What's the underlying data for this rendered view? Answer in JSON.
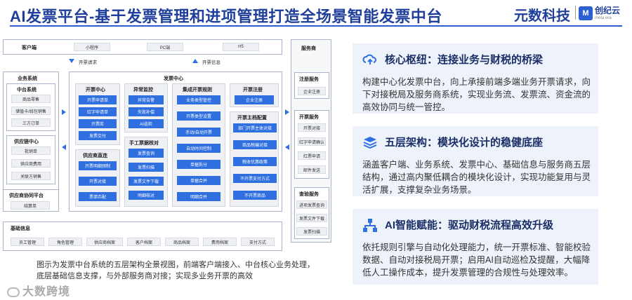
{
  "header": {
    "title": "AI发票平台-基于发票管理和进项管理打造全场景智能发票中台",
    "brand": "元数科技",
    "partner_name": "创纪云",
    "partner_sub": "meta era",
    "partner_mark": "M"
  },
  "diagram": {
    "customer": {
      "label": "客户端",
      "items": [
        "小程序",
        "PC端",
        "H5"
      ]
    },
    "arrows": {
      "request": "开票请求",
      "info": "开票信息"
    },
    "business": {
      "label": "业务系统",
      "center": {
        "label": "中台系统",
        "items": [
          "商品零售",
          "储值卡/线包销售",
          "三方订单"
        ]
      },
      "supply": {
        "label": "供应链中心",
        "items": [
          "批销单",
          "供应商费用",
          "关联方销售"
        ]
      },
      "collab": {
        "label": "供应商协同平台",
        "items": [
          "结算单"
        ]
      }
    },
    "invoice_center": {
      "label": "发票中心",
      "kp": {
        "label": "开票中心",
        "items": [
          "开票申请单",
          "红字申请单",
          "开票库",
          "发票交付"
        ]
      },
      "anomaly": {
        "label": "异常监控",
        "items": [
          "异常告警",
          "失败补偿",
          "AI巡检"
        ]
      },
      "rules": {
        "label": "集成开票规则",
        "items": [
          "业务类型管控",
          "开票类型设置",
          "手动/自动开票",
          "自动时间控制",
          "单据拆分",
          "单据合并",
          "明细合并"
        ]
      },
      "register": {
        "label": "开票注册",
        "items": [
          "企业注册"
        ]
      },
      "manual": {
        "label": "手工票据核对",
        "items": [
          "发票查询",
          "发票扫描",
          "发票文件下载",
          "明细核对"
        ]
      },
      "supplier": {
        "label": "供应商直连",
        "items": [
          "开票明细预制",
          "开票对接",
          "票单匹配"
        ]
      },
      "master": {
        "label": "开票主档配置",
        "items": [
          "部门开票主体对接",
          "商品税编对接",
          "税收优惠政策",
          "不开票支付方式",
          "不开票商品"
        ]
      }
    },
    "service": {
      "label": "服务商",
      "reg": {
        "label": "注册服务",
        "items": [
          "企业注册"
        ]
      },
      "kp": {
        "label": "开票服务",
        "items": [
          "开票对接",
          "红字申请确认",
          "红票申请",
          "邮件发送"
        ]
      },
      "check": {
        "label": "查验服务",
        "items": [
          "进项发票查询",
          "发票文件下载",
          "发票扫描"
        ]
      }
    },
    "base": {
      "label": "基础信息",
      "items": [
        "员工管理",
        "角色管理",
        "供应商档案",
        "客户档案",
        "商品档案",
        "费用档案",
        "支付方式"
      ]
    }
  },
  "caption": "图示为发票中台系统的五层架构全景视图，前端客户端接入、中台核心业务处理，底层基础信息支撑，与外部服务商对接；实现多业务开票的高效",
  "watermark": "大数跨境",
  "panels": [
    {
      "icon": "cloud-sync-icon",
      "title": "核心枢纽：连接业务与财税的桥梁",
      "body": "构建中心化发票中台，向上承接前端多端业务开票请求，向下对接税局及服务商系统，实现业务流、发票流、资金流的高效协同与统一管控。"
    },
    {
      "icon": "layers-icon",
      "title": "五层架构：模块化设计的稳健底座",
      "body": "涵盖客户端、业务系统、发票中心、基础信息与服务商五层结构，通过高内聚低耦合的模块化设计，实现功能复用与灵活扩展，支撑复杂业务场景。"
    },
    {
      "icon": "network-icon",
      "title": "AI智能赋能：驱动财税流程高效升级",
      "body": "依托规则引擎与自动化处理能力，统一开票标准、智能校验数据、自动对接税局开票；启用AI自动巡检及提醒，大幅降低人工操作成本，提升发票管理的合规性与处理效率。"
    }
  ],
  "colors": {
    "accent": "#2f6fe0",
    "title": "#1f3f9a",
    "panel_bg": "#eef3fb"
  }
}
